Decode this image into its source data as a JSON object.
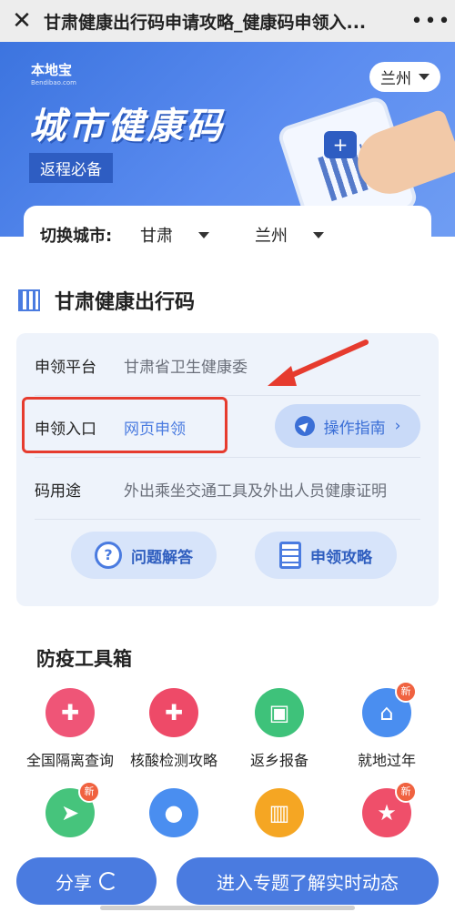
{
  "topbar": {
    "close_icon": "close-icon",
    "title": "甘肃健康出行码申请攻略_健康码申领入...",
    "more_icon": "more-icon"
  },
  "banner": {
    "logo_text": "本地宝",
    "logo_sub": "Bendibao.com",
    "title": "城市健康码",
    "tag": "返程必备",
    "city_button": "兰州"
  },
  "city_switch": {
    "label": "切换城市:",
    "province": "甘肃",
    "city": "兰州"
  },
  "section": {
    "title": "甘肃健康出行码"
  },
  "info": {
    "platform_key": "申领平台",
    "platform_value": "甘肃省卫生健康委",
    "entry_key": "申领入口",
    "entry_value": "网页申领",
    "guide_button": "操作指南",
    "usage_key": "码用途",
    "usage_value": "外出乘坐交通工具及外出人员健康证明",
    "faq_button": "问题解答",
    "apply_button": "申领攻略",
    "highlight_color": "#e63b2e"
  },
  "tools": {
    "title": "防疫工具箱",
    "items": [
      {
        "label": "全国隔离查询",
        "icon": "medicine-bottle-icon",
        "color": "#ef5577",
        "badge": ""
      },
      {
        "label": "核酸检测攻略",
        "icon": "medical-cross-icon",
        "color": "#ee4a68",
        "badge": ""
      },
      {
        "label": "返乡报备",
        "icon": "bus-icon",
        "color": "#3ec27a",
        "badge": ""
      },
      {
        "label": "就地过年",
        "icon": "house-icon",
        "color": "#4a8ef0",
        "badge": "新"
      },
      {
        "label": "",
        "icon": "send-icon",
        "color": "#46c47c",
        "badge": "新"
      },
      {
        "label": "",
        "icon": "location-pin-icon",
        "color": "#4a8ef0",
        "badge": ""
      },
      {
        "label": "",
        "icon": "building-icon",
        "color": "#f5a623",
        "badge": ""
      },
      {
        "label": "",
        "icon": "gift-box-icon",
        "color": "#ef4f6a",
        "badge": "新"
      }
    ]
  },
  "bottom": {
    "share": "分享",
    "enter": "进入专题了解实时动态"
  }
}
